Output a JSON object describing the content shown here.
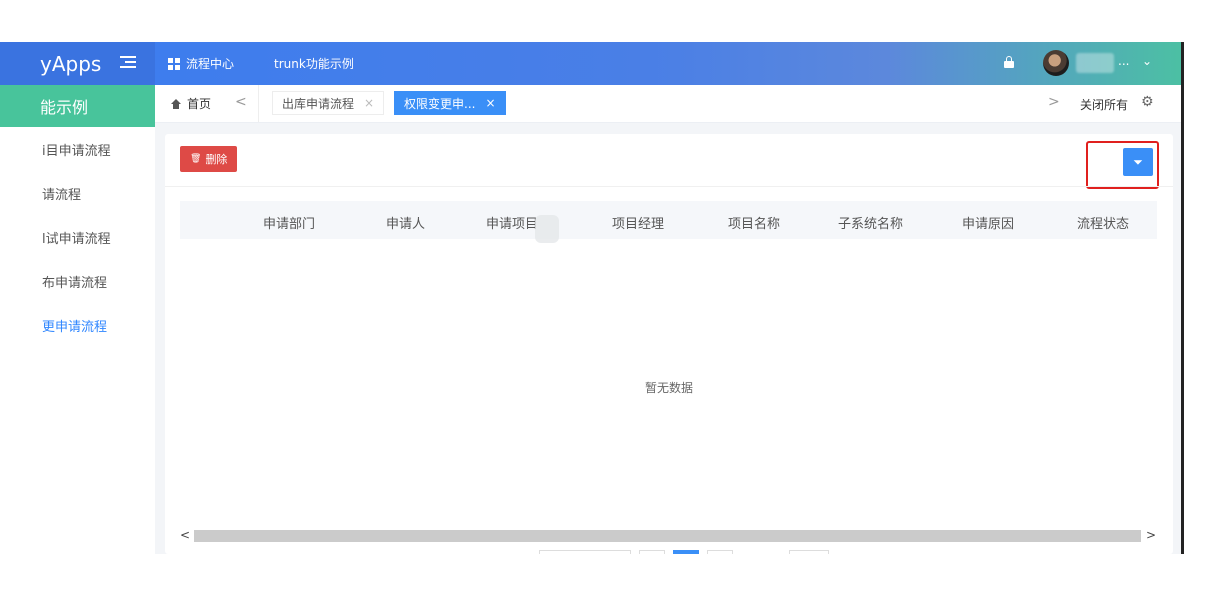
{
  "header": {
    "brand": "yApps",
    "nav": [
      {
        "label": "流程中心",
        "icon": "grid-icon"
      },
      {
        "label": "trunk功能示例"
      }
    ],
    "user_suffix": "... ",
    "colors": {
      "primary": "#3a7cf0",
      "accent": "#48c49b"
    }
  },
  "sidebar": {
    "title": "能示例",
    "items": [
      {
        "label": "i目申请流程"
      },
      {
        "label": "请流程"
      },
      {
        "label": "l试申请流程"
      },
      {
        "label": "布申请流程"
      },
      {
        "label": "更申请流程",
        "active": true
      }
    ]
  },
  "tabs": {
    "home": "首页",
    "items": [
      {
        "label": "出库申请流程",
        "close": "×"
      },
      {
        "label": "权限变更申...",
        "close": "×",
        "active": true
      }
    ],
    "prev": "<",
    "next": ">",
    "close_all": "关闭所有"
  },
  "toolbar": {
    "delete_label": "删除"
  },
  "table": {
    "columns": [
      "申请部门",
      "申请人",
      "申请项目",
      "项目经理",
      "项目名称",
      "子系统名称",
      "申请原因",
      "流程状态"
    ],
    "empty_text": "暂无数据"
  },
  "scroll": {
    "left": "<",
    "right": ">"
  }
}
